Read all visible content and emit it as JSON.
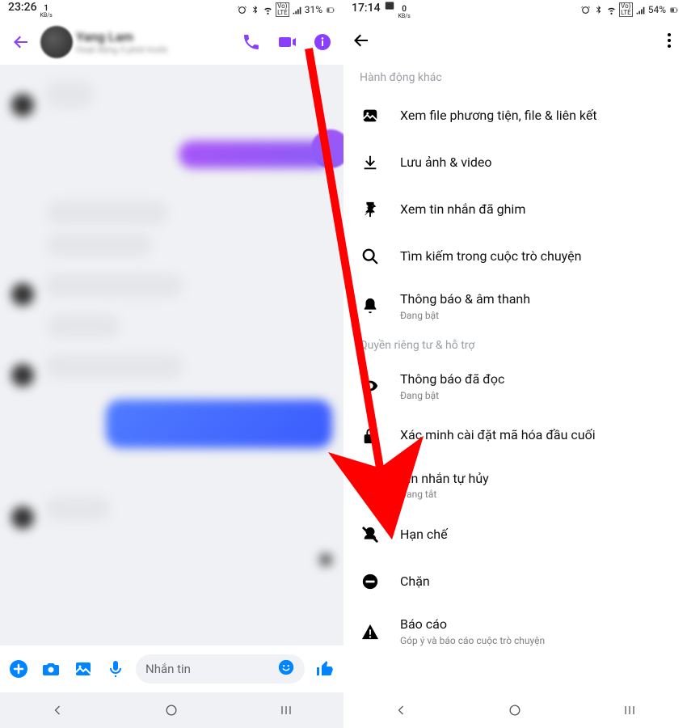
{
  "left": {
    "status": {
      "time": "23:26",
      "kb_num": "1",
      "kb_unit": "KB/s",
      "battery": "31%"
    },
    "header": {
      "contact_name": "Yang Lam",
      "contact_sub": "Hoạt động 3 phút trước"
    },
    "compose": {
      "placeholder": "Nhắn tin"
    }
  },
  "right": {
    "status": {
      "time": "17:14",
      "kb_num": "0",
      "kb_unit": "KB/s",
      "battery": "54%"
    },
    "sections": {
      "actions_title": "Hành động khác",
      "privacy_title": "Quyền riêng tư & hỗ trợ"
    },
    "items": {
      "media": "Xem file phương tiện, file & liên kết",
      "save": "Lưu ảnh & video",
      "pinned": "Xem tin nhắn đã ghim",
      "search": "Tìm kiếm trong cuộc trò chuyện",
      "notif": "Thông báo & âm thanh",
      "notif_sub": "Đang bật",
      "read": "Thông báo đã đọc",
      "read_sub": "Đang bật",
      "e2e": "Xác minh cài đặt mã hóa đầu cuối",
      "disappear": "Tin nhắn tự hủy",
      "disappear_sub": "Đang tắt",
      "restrict": "Hạn chế",
      "block": "Chặn",
      "report": "Báo cáo",
      "report_sub": "Góp ý và báo cáo cuộc trò chuyện"
    }
  }
}
